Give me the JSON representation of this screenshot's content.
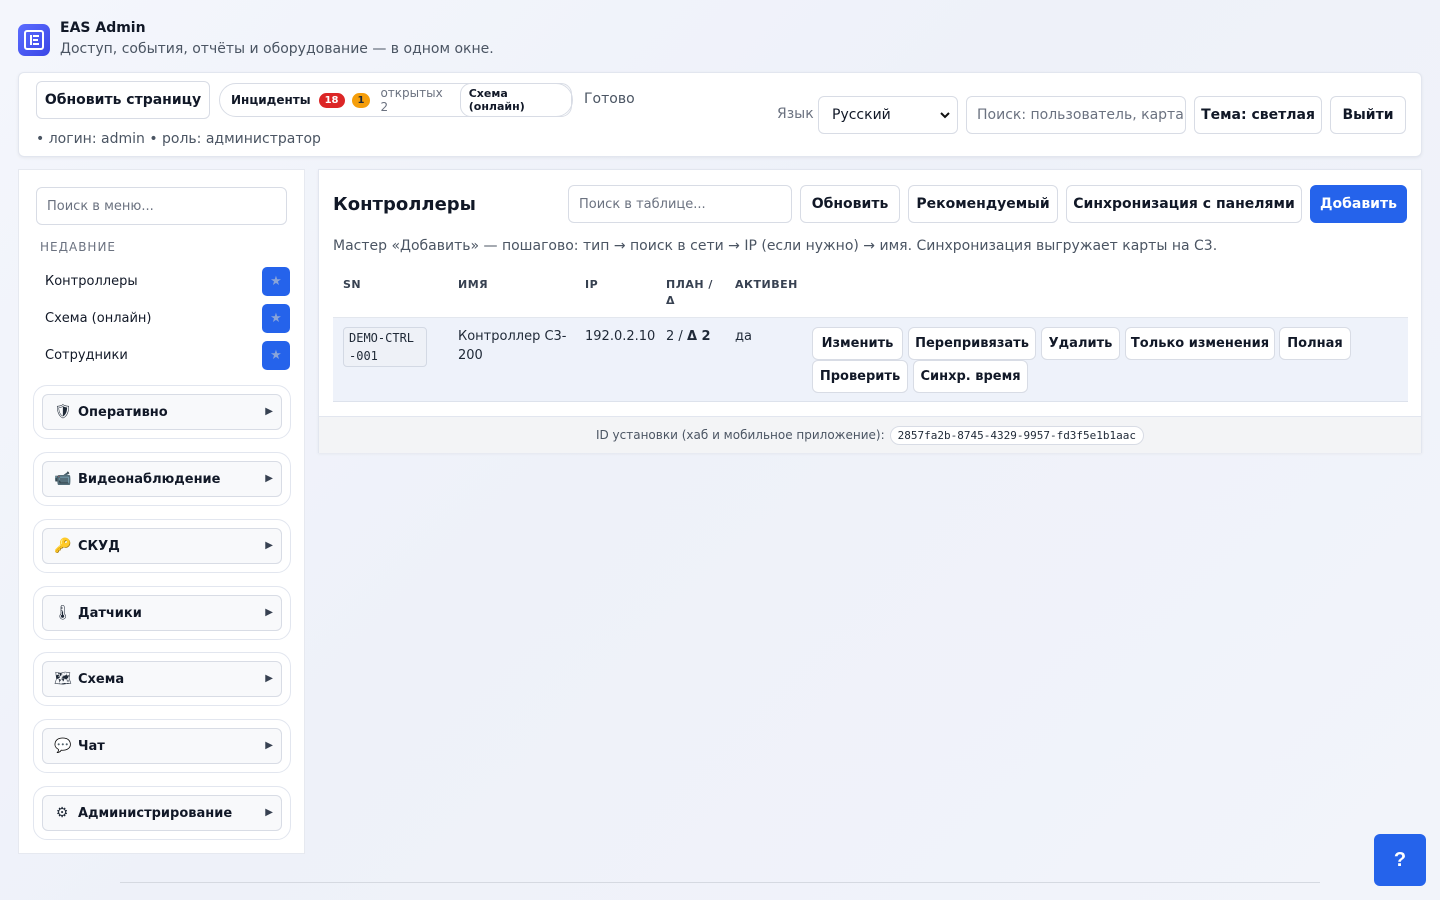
{
  "header": {
    "app_title": "EAS Admin",
    "subtitle": "Доступ, события, отчёты и оборудование — в одном окне."
  },
  "toolbar": {
    "refresh_page": "Обновить страницу",
    "incidents_label": "Инциденты",
    "incidents_red_count": "18",
    "incidents_orange_count": "1",
    "open_count": "открытых 2",
    "scheme_chip": "Схема (онлайн)",
    "status": "Готово",
    "login_info": "• логин: admin • роль: администратор",
    "language_label": "Язык",
    "language_value": "Русский",
    "search_placeholder": "Поиск: пользователь, карта",
    "theme_button": "Тема: светлая",
    "logout_button": "Выйти"
  },
  "sidebar": {
    "menu_search_placeholder": "Поиск в меню...",
    "recent_title": "НЕДАВНИЕ",
    "recent": [
      {
        "label": "Контроллеры"
      },
      {
        "label": "Схема (онлайн)"
      },
      {
        "label": "Сотрудники"
      }
    ],
    "star_glyph": "★",
    "groups": [
      {
        "icon": "🛡",
        "icon_name": "shield-icon",
        "label": "Оперативно"
      },
      {
        "icon": "📹",
        "icon_name": "video-camera-icon",
        "label": "Видеонаблюдение"
      },
      {
        "icon": "🔑",
        "icon_name": "key-icon",
        "label": "СКУД"
      },
      {
        "icon": "🌡",
        "icon_name": "thermometer-icon",
        "label": "Датчики"
      },
      {
        "icon": "🗺",
        "icon_name": "map-icon",
        "label": "Схема"
      },
      {
        "icon": "💬",
        "icon_name": "chat-bubble-icon",
        "label": "Чат"
      },
      {
        "icon": "⚙",
        "icon_name": "gear-icon",
        "label": "Администрирование"
      }
    ],
    "group_arrow": "▶"
  },
  "main": {
    "title": "Контроллеры",
    "table_search_placeholder": "Поиск в таблице...",
    "buttons": {
      "refresh": "Обновить",
      "recommended": "Рекомендуемый",
      "sync": "Синхронизация с панелями",
      "add": "Добавить"
    },
    "hint": "Мастер «Добавить» — пошагово: тип → поиск в сети → IP (если нужно) → имя. Синхронизация выгружает карты на C3.",
    "columns": {
      "sn": "SN",
      "name": "ИМЯ",
      "ip": "IP",
      "plan": "ПЛАН / Δ",
      "active": "АКТИВЕН"
    },
    "row": {
      "sn": "DEMO-CTRL-001",
      "name": "Контроллер C3-200",
      "ip": "192.0.2.10",
      "plan": "2 /",
      "delta": "Δ 2",
      "active": "да"
    },
    "row_actions": {
      "edit": "Изменить",
      "rebind": "Перепривязать",
      "delete": "Удалить",
      "only_changes": "Только изменения",
      "full": "Полная",
      "check": "Проверить",
      "sync_time": "Синхр. время"
    },
    "footer": {
      "install_label": "ID установки (хаб и мобильное приложение):",
      "install_id": "2857fa2b-8745-4329-9957-fd3f5e1b1aac"
    }
  },
  "help_button": "?",
  "colors": {
    "primary": "#2563eb",
    "badge_red": "#dc2626",
    "badge_orange": "#f59e0b"
  }
}
